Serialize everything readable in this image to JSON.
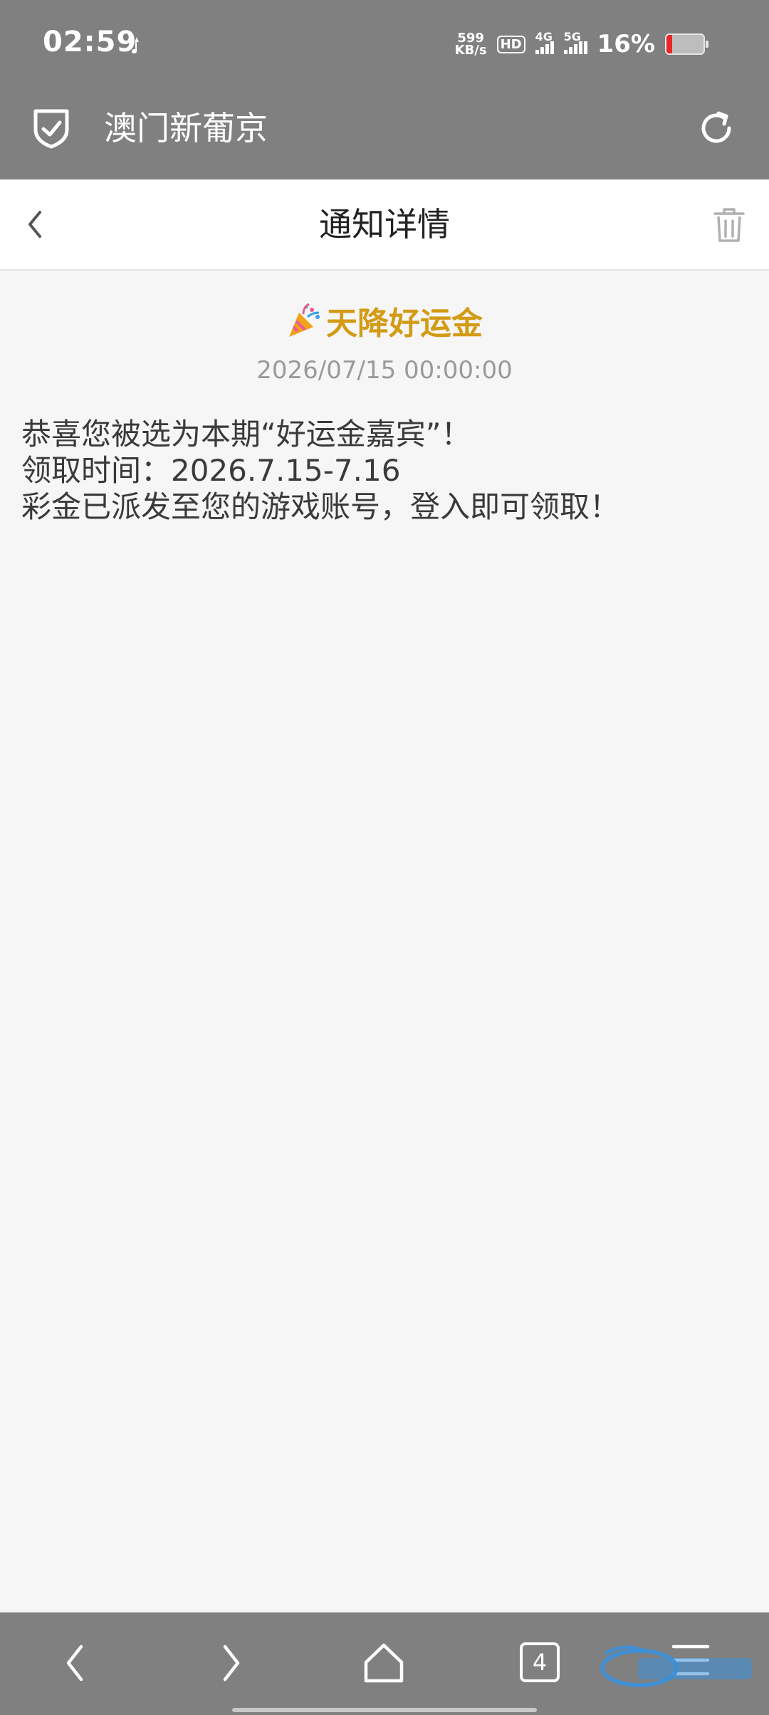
{
  "status_bar": {
    "time": "02:59",
    "net_speed_value": "599",
    "net_speed_unit": "KB/s",
    "hd_label": "HD",
    "signal1_label": "4G",
    "signal2_label": "5G",
    "battery_percent": "16%",
    "battery_level": 0.16,
    "battery_color": "#e8262a"
  },
  "browser": {
    "site_title": "澳门新葡京",
    "icons": {
      "left": "shield-check-icon",
      "right": "reload-icon"
    }
  },
  "header": {
    "title": "通知详情",
    "back_icon": "chevron-left-icon",
    "delete_icon": "trash-icon"
  },
  "notice": {
    "title": "天降好运金",
    "title_color": "#d39b15",
    "title_icon": "party-popper-icon",
    "timestamp": "2026/07/15 00:00:00",
    "body_lines": [
      "恭喜您被选为本期“好运金嘉宾”！",
      "领取时间：2026.7.15-7.16",
      "彩金已派发至您的游戏账号，登入即可领取！"
    ]
  },
  "bottom_nav": {
    "tab_count": "4",
    "icons": [
      "back-icon",
      "forward-icon",
      "home-icon",
      "tabs-icon",
      "menu-icon"
    ]
  }
}
